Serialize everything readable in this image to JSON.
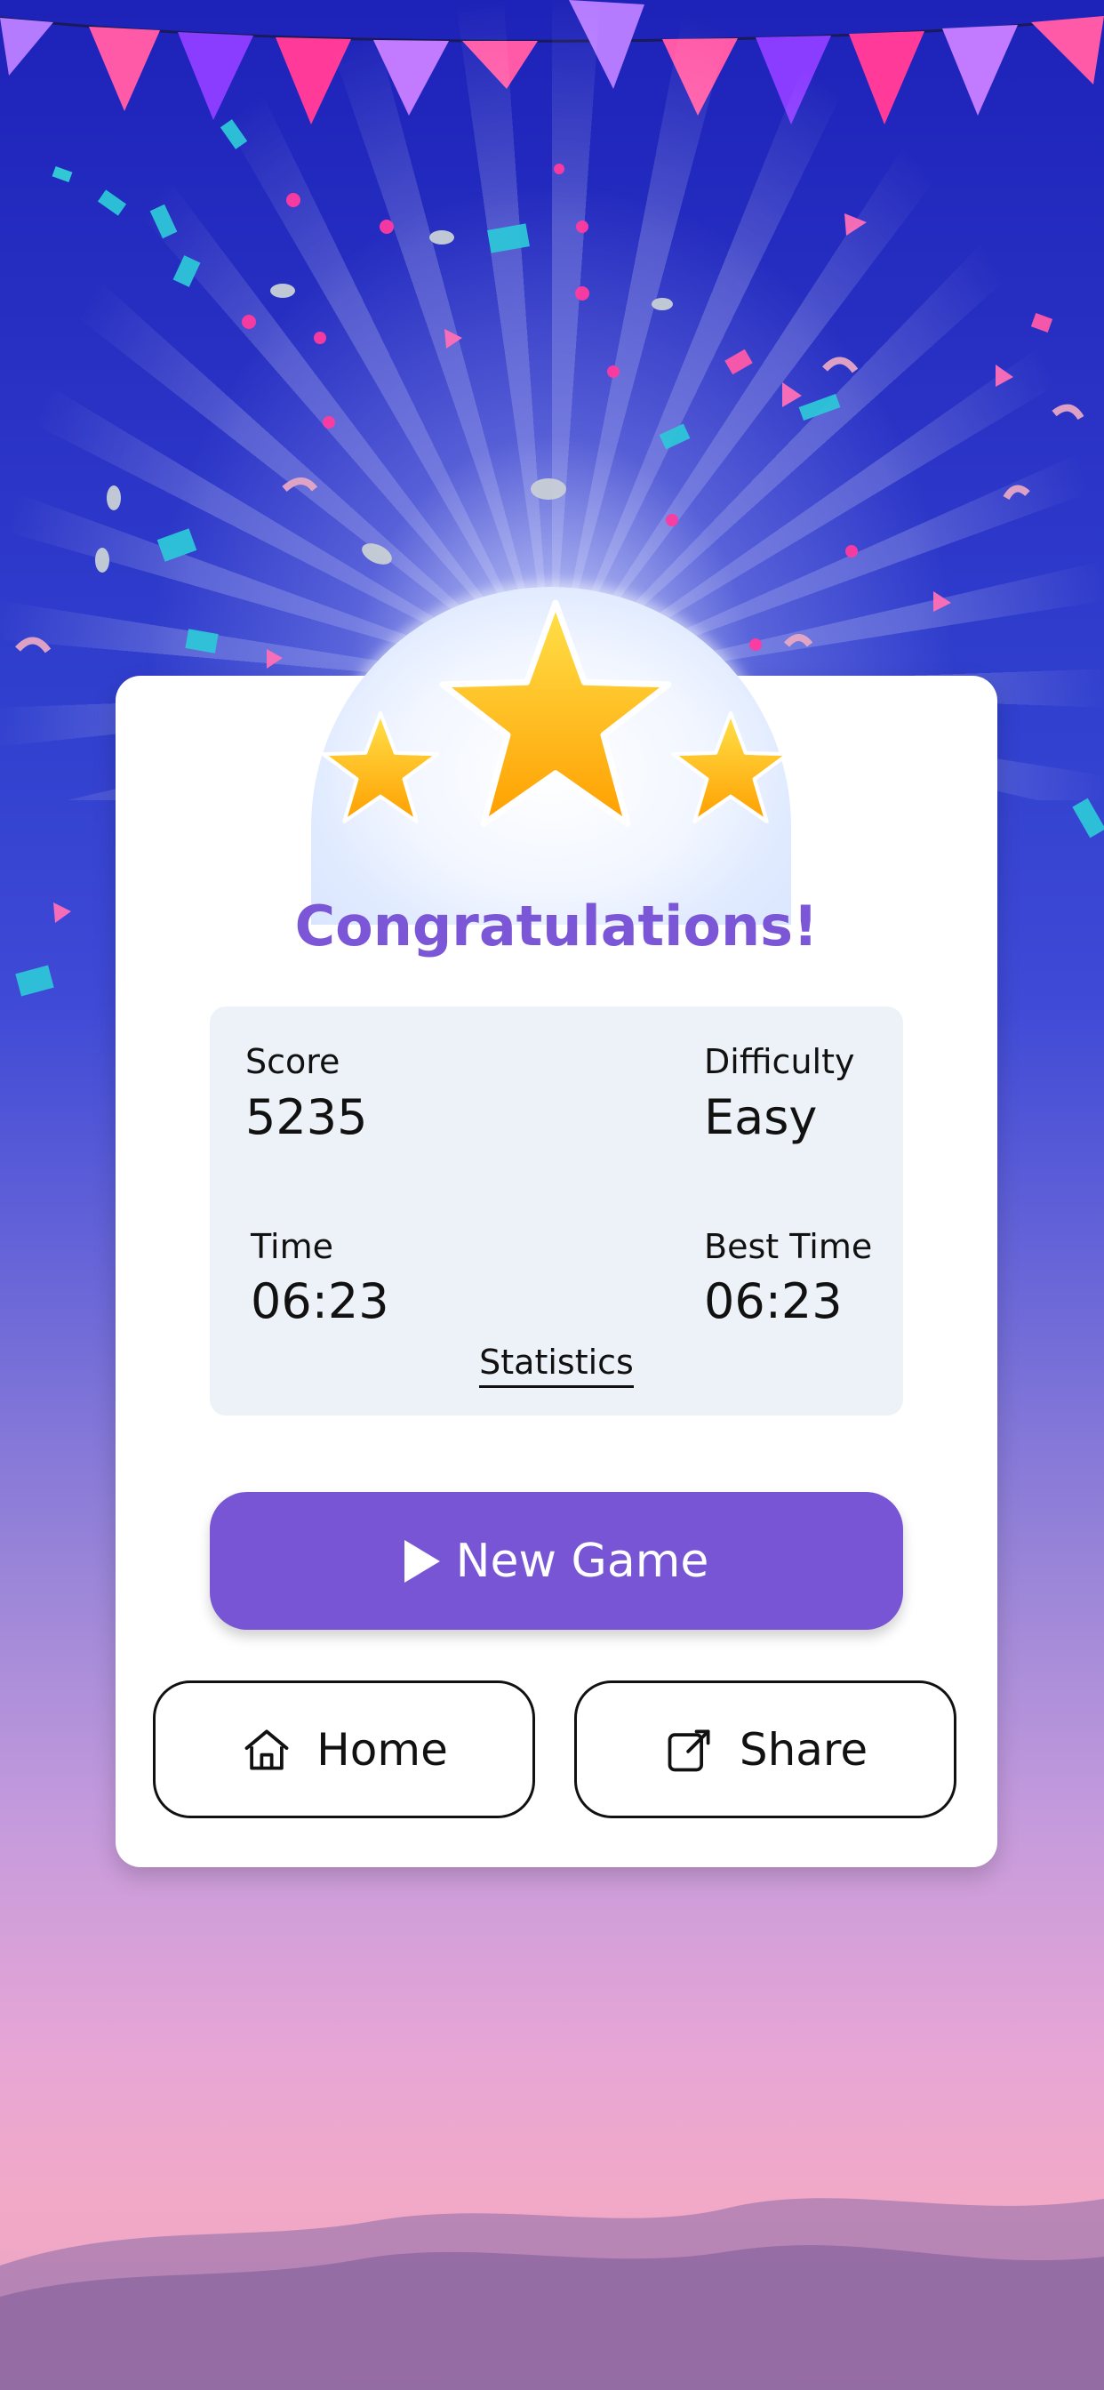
{
  "title": "Congratulations!",
  "stats": {
    "score_label": "Score",
    "score_value": "5235",
    "difficulty_label": "Difficulty",
    "difficulty_value": "Easy",
    "time_label": "Time",
    "time_value": "06:23",
    "best_time_label": "Best Time",
    "best_time_value": "06:23",
    "statistics_link": "Statistics"
  },
  "buttons": {
    "new_game": "New Game",
    "home": "Home",
    "share": "Share"
  },
  "icons": {
    "new_game": "play-icon",
    "home": "home-icon",
    "share": "share-icon"
  },
  "rating": {
    "stars": 3,
    "max": 3
  },
  "colors": {
    "accent": "#7755d4",
    "title": "#7b56d6",
    "star": "#ffc21a",
    "card": "#ffffff",
    "stats_bg": "#edf2f8"
  }
}
